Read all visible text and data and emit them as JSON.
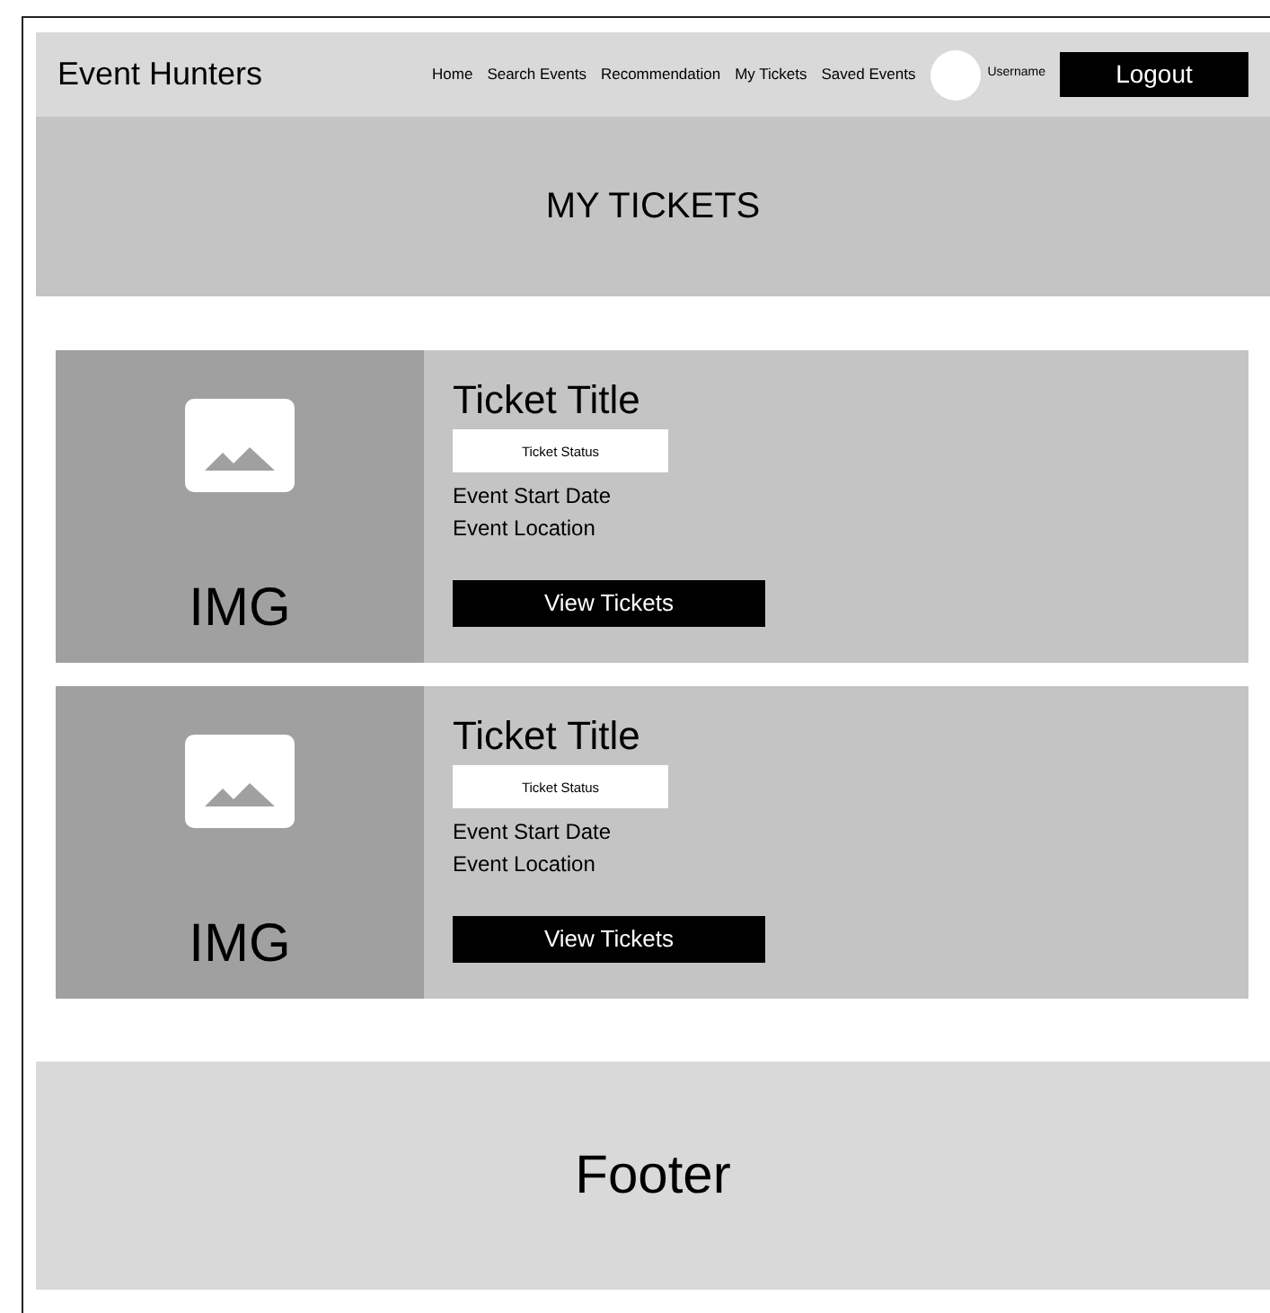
{
  "header": {
    "brand": "Event Hunters",
    "nav": [
      {
        "label": "Home"
      },
      {
        "label": "Search Events"
      },
      {
        "label": "Recommendation"
      },
      {
        "label": "My Tickets"
      },
      {
        "label": "Saved Events"
      }
    ],
    "username": "Username",
    "logout": "Logout"
  },
  "page_title": "MY TICKETS",
  "tickets": [
    {
      "image_label": "IMG",
      "title": "Ticket Title",
      "status": "Ticket Status",
      "start_date": "Event Start Date",
      "location": "Event Location",
      "button": "View Tickets"
    },
    {
      "image_label": "IMG",
      "title": "Ticket Title",
      "status": "Ticket Status",
      "start_date": "Event Start Date",
      "location": "Event Location",
      "button": "View Tickets"
    }
  ],
  "footer": "Footer"
}
